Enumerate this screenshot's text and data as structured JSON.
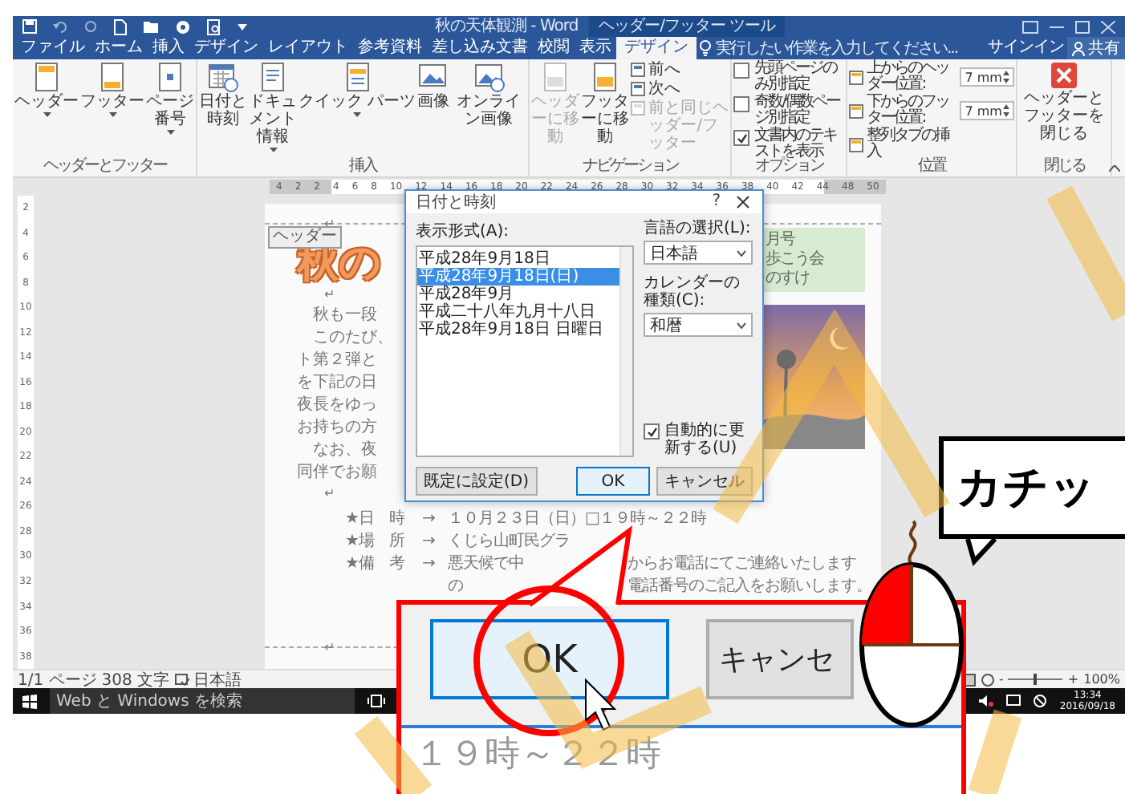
{
  "window": {
    "title": "秋の天体観測 - Word",
    "context_tab": "ヘッダー/フッター ツール"
  },
  "tabs": [
    {
      "label": "ファイル",
      "selected": false
    },
    {
      "label": "ホーム",
      "selected": false
    },
    {
      "label": "挿入",
      "selected": false
    },
    {
      "label": "デザイン",
      "selected": false
    },
    {
      "label": "レイアウト",
      "selected": false
    },
    {
      "label": "参考資料",
      "selected": false
    },
    {
      "label": "差し込み文書",
      "selected": false
    },
    {
      "label": "校閲",
      "selected": false
    },
    {
      "label": "表示",
      "selected": false
    },
    {
      "label": "デザイン",
      "selected": true
    }
  ],
  "tell_me": {
    "placeholder": "実行したい作業を入力してください..."
  },
  "account": {
    "sign_in": "サインイン",
    "share": "共有"
  },
  "ribbon_groups": [
    {
      "label": "ヘッダーとフッター",
      "kind": "large",
      "buttons": [
        {
          "label": "ヘッダー",
          "dropdown": true,
          "disabled": false
        },
        {
          "label": "フッター",
          "dropdown": true,
          "disabled": false
        },
        {
          "label": "ページ番号",
          "dropdown": true,
          "disabled": false
        }
      ]
    },
    {
      "label": "挿入",
      "kind": "large",
      "buttons": [
        {
          "label": "日付と時刻",
          "dropdown": false,
          "disabled": false
        },
        {
          "label": "ドキュメント情報",
          "dropdown": true,
          "disabled": false
        },
        {
          "label": "クイック パーツ",
          "dropdown": true,
          "disabled": false
        },
        {
          "label": "画像",
          "dropdown": false,
          "disabled": false
        },
        {
          "label": "オンライン画像",
          "dropdown": false,
          "disabled": false
        }
      ]
    },
    {
      "label": "ナビゲーション",
      "kind": "nav",
      "buttons": [
        {
          "label": "ヘッダーに移動",
          "dropdown": false,
          "disabled": true
        },
        {
          "label": "フッターに移動",
          "dropdown": false,
          "disabled": false
        }
      ],
      "items": [
        {
          "label": "前へ",
          "disabled": false
        },
        {
          "label": "次へ",
          "disabled": false
        },
        {
          "label": "前と同じヘッダー/フッター",
          "disabled": true
        }
      ]
    },
    {
      "label": "オプション",
      "kind": "checks",
      "items": [
        {
          "label": "先頭ページのみ別指定",
          "checked": false
        },
        {
          "label": "奇数/偶数ページ別指定",
          "checked": false
        },
        {
          "label": "文書内のテキストを表示",
          "checked": true
        }
      ]
    },
    {
      "label": "位置",
      "kind": "position",
      "items": [
        {
          "label": "上からのヘッダー位置:",
          "value": "7 mm"
        },
        {
          "label": "下からのフッター位置:",
          "value": "7 mm"
        },
        {
          "label": "整列タブの挿入"
        }
      ]
    },
    {
      "label": "閉じる",
      "kind": "large",
      "buttons": [
        {
          "label": "ヘッダーとフッターを閉じる",
          "dropdown": false,
          "disabled": false
        }
      ]
    }
  ],
  "ruler": {
    "numbers": [
      "4",
      "2",
      "2",
      "4",
      "6",
      "8",
      "10",
      "12",
      "14",
      "16",
      "18",
      "20",
      "22",
      "24",
      "26",
      "28",
      "30",
      "32",
      "34",
      "36",
      "38",
      "40",
      "42",
      "44",
      "48",
      "50"
    ]
  },
  "vertical_ruler": {
    "numbers": [
      "2",
      "4",
      "6",
      "8",
      "10",
      "12",
      "14",
      "16",
      "18",
      "20",
      "22",
      "24",
      "26",
      "28",
      "30",
      "32",
      "34",
      "36",
      "38"
    ]
  },
  "document": {
    "header_tag": "ヘッダー",
    "marks": [
      "↵",
      "↵",
      "↵",
      "↵"
    ],
    "title": "秋の",
    "body_lines": [
      "　秋も一段",
      "　このたび、",
      "ト第２弾と",
      "を下記の日",
      "夜長をゆっ",
      "お持ちの方",
      "　なお、夜",
      "同伴でお願"
    ],
    "side_lines": [
      "月号",
      "歩こう会",
      "のすけ"
    ],
    "details": [
      {
        "label": "★日　時",
        "tab": "→",
        "value": "１０月２３日（日）□１９時～２２時"
      },
      {
        "label": "★場　所",
        "tab": "→",
        "value": "くじら山町民グラ"
      },
      {
        "label": "★備　考",
        "tab": "→",
        "value": "悪天候で中",
        "continuation": "からお電話にてご連絡いたします"
      },
      {
        "value": "の",
        "continuation": "電話番号のご記入をお願いします。"
      }
    ]
  },
  "dialog": {
    "title": "日付と時刻",
    "help": "?",
    "format_label": "表示形式(A):",
    "formats": [
      {
        "label": "平成28年9月18日",
        "selected": false
      },
      {
        "label": "平成28年9月18日(日)",
        "selected": true
      },
      {
        "label": "平成28年9月",
        "selected": false
      },
      {
        "label": "平成二十八年九月十八日",
        "selected": false
      },
      {
        "label": "平成28年9月18日 日曜日",
        "selected": false
      }
    ],
    "language_label": "言語の選択(L):",
    "language": "日本語",
    "calendar_label": "カレンダーの種類(C):",
    "calendar": "和暦",
    "auto_update": {
      "label": "自動的に更新する(U)",
      "checked": true
    },
    "default_button": "既定に設定(D)",
    "ok": "OK",
    "cancel": "キャンセル"
  },
  "status_bar": {
    "page": "1/1 ページ",
    "words": "308 文字",
    "language": "日本語",
    "zoom_minus": "-",
    "zoom_plus": "+",
    "zoom": "100%",
    "zoom_slider": {
      "level": 0.5
    }
  },
  "taskbar": {
    "search": {
      "placeholder": "Web と Windows を検索"
    },
    "time": "13:34",
    "date": "2016/09/18"
  },
  "callout": {
    "ok": "OK",
    "cancel": "キャンセ",
    "text": "１９時～２２時"
  },
  "speech_bubble": {
    "text": "カチッ"
  }
}
